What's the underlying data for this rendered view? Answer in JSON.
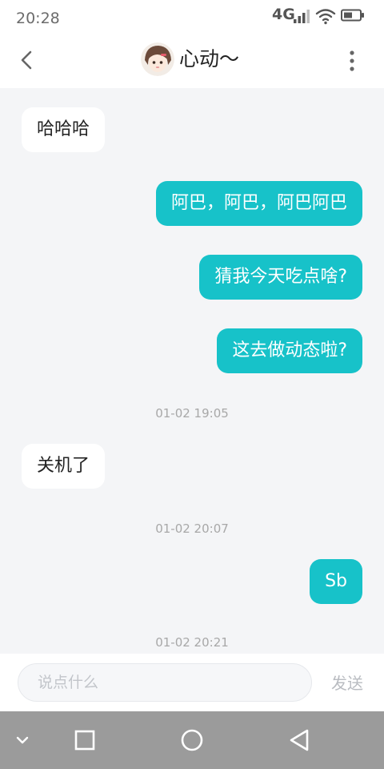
{
  "status_bar": {
    "time": "20:28",
    "network": "4G"
  },
  "header": {
    "title": "心动〜"
  },
  "messages": [
    {
      "side": "in",
      "text": "哈哈哈"
    },
    {
      "side": "out",
      "text": "阿巴，阿巴，阿巴阿巴"
    },
    {
      "side": "out",
      "text": "猜我今天吃点啥?"
    },
    {
      "side": "out",
      "text": "这去做动态啦?"
    },
    {
      "side": "in",
      "text": "关机了"
    },
    {
      "side": "out",
      "text": "Sb"
    }
  ],
  "timestamps": [
    "01-02 19:05",
    "01-02 20:07",
    "01-02 20:21"
  ],
  "input": {
    "placeholder": "说点什么",
    "send_label": "发送"
  },
  "colors": {
    "accent": "#17c2c9",
    "background": "#f4f5f7",
    "nav_bar": "#9b9b9b"
  }
}
